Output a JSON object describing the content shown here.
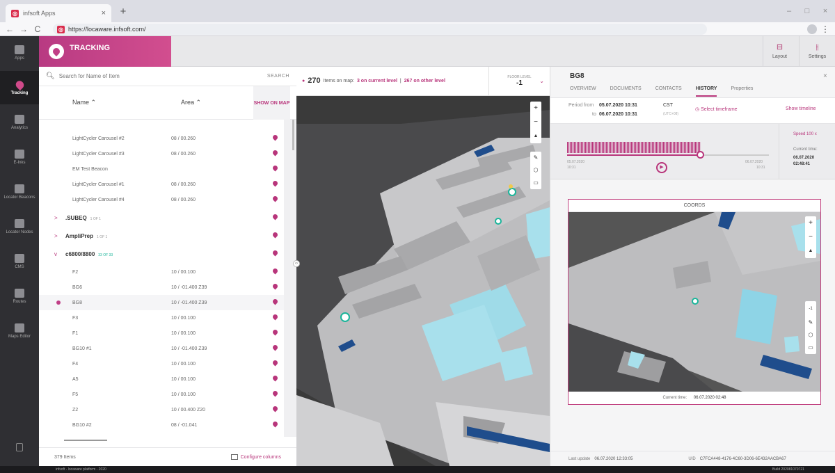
{
  "browser": {
    "tab_title": "infsoft Apps",
    "tab_close": "×",
    "new_tab": "+",
    "url": "https://locaware.infsoft.com/",
    "back": "←",
    "forward": "→",
    "reload": "C",
    "minimize": "–",
    "maximize": "□",
    "close": "×"
  },
  "rail": {
    "items": [
      {
        "label": "Apps"
      },
      {
        "label": "Tracking"
      },
      {
        "label": "Analytics"
      },
      {
        "label": "E-Inks"
      },
      {
        "label": "Locator Beacons"
      },
      {
        "label": "Locator Nodes"
      },
      {
        "label": "CMS"
      },
      {
        "label": "Routes"
      },
      {
        "label": "Maps Editor"
      }
    ]
  },
  "header": {
    "title": "TRACKING",
    "layout_label": "Layout",
    "settings_label": "Settings"
  },
  "list": {
    "search_placeholder": "Search for Name of Item",
    "search_button": "SEARCH",
    "col_name": "Name",
    "col_area": "Area",
    "col_show": "SHOW ON MAP",
    "rows": [
      {
        "name": "LightCycler Carousel #2",
        "area": "08 / 00.260"
      },
      {
        "name": "LightCycler Carousel #3",
        "area": "08 / 00.260"
      },
      {
        "name": "EM Test Beacon",
        "area": ""
      },
      {
        "name": "LightCycler Carousel #1",
        "area": "08 / 00.260"
      },
      {
        "name": "LightCycler Carousel #4",
        "area": "08 / 00.260"
      }
    ],
    "groups": [
      {
        "name": ".SUBEQ",
        "count": "1 OF 1",
        "chev": ">"
      },
      {
        "name": "AmpliPrep",
        "count": "1 OF 1",
        "chev": ">"
      },
      {
        "name": "c6800/8800",
        "count": "33 OF 33",
        "chev": "v"
      }
    ],
    "sub_rows": [
      {
        "name": "F2",
        "area": "10 / 00.100"
      },
      {
        "name": "BG6",
        "area": "10 / -01.400 Z39"
      },
      {
        "name": "BG8",
        "area": "10 / -01.400 Z39"
      },
      {
        "name": "F3",
        "area": "10 / 00.100"
      },
      {
        "name": "F1",
        "area": "10 / 00.100"
      },
      {
        "name": "BG10 #1",
        "area": "10 / -01.400 Z39"
      },
      {
        "name": "F4",
        "area": "10 / 00.100"
      },
      {
        "name": "A5",
        "area": "10 / 00.100"
      },
      {
        "name": "F5",
        "area": "10 / 00.100"
      },
      {
        "name": "Z2",
        "area": "10 / 00.400 Z20"
      },
      {
        "name": "BG10 #2",
        "area": "08 / -01.041"
      }
    ],
    "footer_count": "379 Items",
    "configure": "Configure columns"
  },
  "map": {
    "count": "270",
    "items_on_map": "Items on map:",
    "current_level": "3 on current level",
    "separator": "|",
    "other_level": "267 on other level",
    "floor_label": "FLOOR LEVEL",
    "floor_value": "-1",
    "zoom_in": "+",
    "zoom_out": "−",
    "compass": "▲",
    "handle": "‹›"
  },
  "detail": {
    "title": "BG8",
    "close": "×",
    "tabs": [
      "OVERVIEW",
      "DOCUMENTS",
      "CONTACTS",
      "HISTORY",
      "Properties"
    ],
    "period_from_label": "Period from",
    "period_from": "05.07.2020 10:31",
    "to_label": "to",
    "period_to": "06.07.2020 10:31",
    "tz": "CST",
    "tz_sub": "(UTC+08)",
    "select_timeframe": "Select timeframe",
    "show_timeline": "Show timeline",
    "tl_start": "05.07.2020",
    "tl_start_time": "10:31",
    "tl_end": "06.07.2020",
    "tl_end_time": "10:31",
    "speed": "Speed 100 x",
    "current_time_label": "Current time:",
    "current_date": "06.07.2020",
    "current_clock": "02:48:41",
    "coords_title": "COORDS",
    "coords_current_label": "Current time:",
    "coords_current": "06.07.2020 02:48",
    "level_readout": "-1",
    "last_update_label": "Last update",
    "last_update": "06.07.2020 12:33:05",
    "uid_label": "UID",
    "uid": "C7FCA448-4176-4C60-3D06-6E432AACBA67"
  },
  "footer": {
    "left": "infsoft - locaware platform - 2020",
    "right": "Build 202081070721"
  },
  "colors": {
    "accent": "#b8357b",
    "teal": "#1ab59a",
    "rail": "#2f2f33"
  }
}
